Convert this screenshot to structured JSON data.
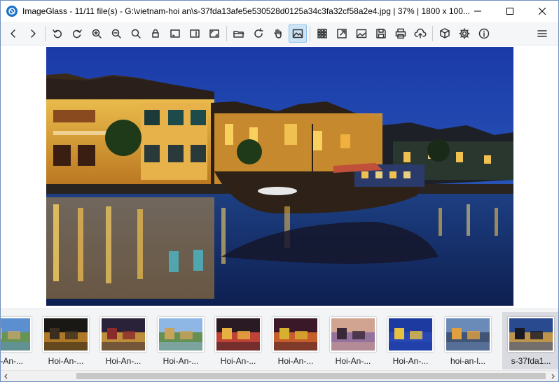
{
  "titlebar": {
    "app_name": "ImageGlass",
    "title": "ImageGlass - 11/11 file(s) - G:\\vietnam-hoi an\\s-37fda13afe5e530528d0125a34c3fa32cf58a2e4.jpg | 37% | 1800 x 100..."
  },
  "toolbar": {
    "buttons": [
      "back",
      "forward",
      "rotate-left",
      "rotate-right",
      "zoom-in",
      "zoom-out",
      "zoom-actual",
      "lock-zoom",
      "fit-width",
      "fit-height",
      "fit-window",
      "open",
      "refresh",
      "pan",
      "image-view",
      "thumbnails",
      "fullscreen",
      "slideshow",
      "save",
      "print",
      "upload",
      "plugin",
      "settings",
      "about",
      "menu"
    ]
  },
  "viewer": {
    "zoom": "37%",
    "dimensions": "1800 x 100..."
  },
  "thumbnails": [
    {
      "label": "oi-An-...",
      "colors": [
        "#5b8fd0",
        "#6a9440",
        "#c2a56a"
      ]
    },
    {
      "label": "Hoi-An-...",
      "colors": [
        "#1a1814",
        "#c98a2c",
        "#3a2e20"
      ]
    },
    {
      "label": "Hoi-An-...",
      "colors": [
        "#2a2238",
        "#d8a03a",
        "#8a2a2a"
      ]
    },
    {
      "label": "Hoi-An-...",
      "colors": [
        "#8fb7e6",
        "#5d8a3a",
        "#c9a35c"
      ]
    },
    {
      "label": "Hoi-An-...",
      "colors": [
        "#2a1a24",
        "#d84a3a",
        "#e8b040"
      ]
    },
    {
      "label": "Hoi-An-...",
      "colors": [
        "#3a1828",
        "#e06a2a",
        "#d8b030"
      ]
    },
    {
      "label": "Hoi-An-...",
      "colors": [
        "#d0a490",
        "#8a6aa0",
        "#3a2838"
      ]
    },
    {
      "label": "Hoi-An-...",
      "colors": [
        "#1c3aa0",
        "#2a4ab8",
        "#e8c040"
      ]
    },
    {
      "label": "hoi-an-l...",
      "colors": [
        "#6a8ab8",
        "#3a4a6a",
        "#e0a040"
      ]
    },
    {
      "label": "s-37fda1...",
      "colors": [
        "#2a4a90",
        "#d8a040",
        "#1a1a24"
      ],
      "selected": true
    }
  ],
  "colors": {
    "accent": "#1a73c9",
    "active_button": "#cce4f7",
    "strip_background": "#f3f4f6"
  }
}
